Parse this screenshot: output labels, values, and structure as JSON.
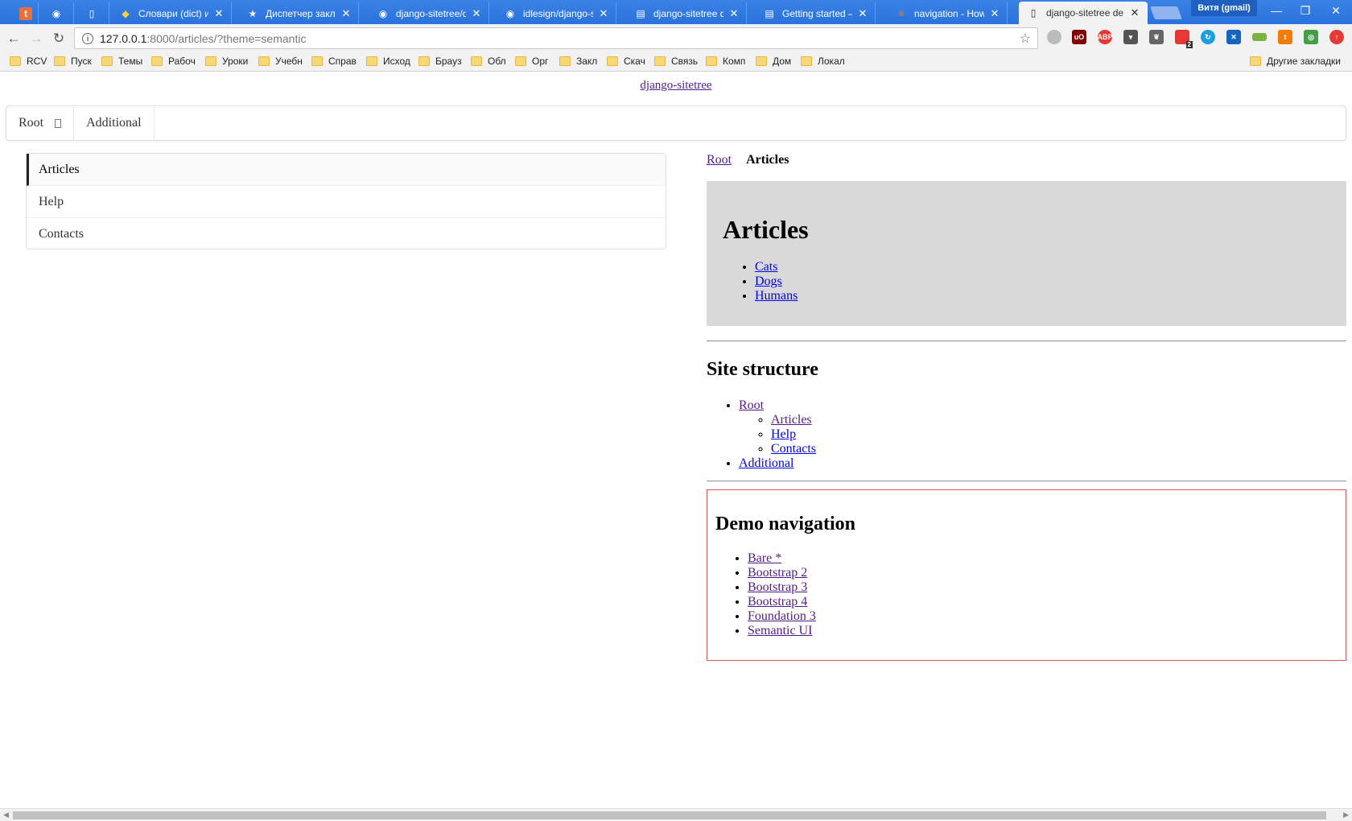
{
  "browser": {
    "tabs": [
      {
        "title": "",
        "icon": "t-brand-icon",
        "glyph": "t"
      },
      {
        "title": "",
        "icon": "github-icon",
        "glyph": "◉"
      },
      {
        "title": "",
        "icon": "blank-page-icon",
        "glyph": "▯"
      },
      {
        "title": "Словари (dict) и р",
        "icon": "python-icon",
        "glyph": "◆"
      },
      {
        "title": "Диспетчер заклад",
        "icon": "star-icon",
        "glyph": "★"
      },
      {
        "title": "django-sitetree/de",
        "icon": "github-icon",
        "glyph": "◉"
      },
      {
        "title": "idlesign/django-site",
        "icon": "github-icon",
        "glyph": "◉"
      },
      {
        "title": "django-sitetree do",
        "icon": "docs-icon",
        "glyph": "▤"
      },
      {
        "title": "Getting started — c",
        "icon": "docs-icon",
        "glyph": "▤"
      },
      {
        "title": "navigation - How t",
        "icon": "stackoverflow-icon",
        "glyph": "≡"
      },
      {
        "title": "django-sitetree de",
        "icon": "blank-page-icon",
        "glyph": "▯"
      }
    ],
    "profile": "Витя (gmail)",
    "url_host": "127.0.0.1",
    "url_rest": ":8000/articles/?theme=semantic",
    "bookmarks": [
      "RCV",
      "Пуск",
      "Темы",
      "Рабоч",
      "Уроки",
      "Учебн",
      "Справ",
      "Исход",
      "Брауз",
      "Обл",
      "Орг",
      "Закл",
      "Скач",
      "Связь",
      "Комп",
      "Дом",
      "Локал"
    ],
    "other_bookmarks": "Другие закладки",
    "extension_badge": "2"
  },
  "page": {
    "site_title": "django-sitetree",
    "top_menu": [
      "Root",
      "Additional"
    ],
    "side_menu": [
      "Articles",
      "Help",
      "Contacts"
    ],
    "breadcrumb": {
      "root": "Root",
      "current": "Articles"
    },
    "articles": {
      "heading": "Articles",
      "items": [
        "Cats",
        "Dogs",
        "Humans"
      ]
    },
    "site_structure": {
      "heading": "Site structure",
      "root": "Root",
      "children": [
        "Articles",
        "Help",
        "Contacts"
      ],
      "additional": "Additional"
    },
    "demo_nav": {
      "heading": "Demo navigation",
      "items": [
        "Bare *",
        "Bootstrap 2",
        "Bootstrap 3",
        "Bootstrap 4",
        "Foundation 3",
        "Semantic UI"
      ]
    }
  },
  "colors": {
    "tabstrip": "#2b78e4",
    "panel_grey": "#d9d9d9",
    "demo_border": "#d9534f",
    "link": "#0000ee",
    "visited_link": "#551a8b"
  }
}
